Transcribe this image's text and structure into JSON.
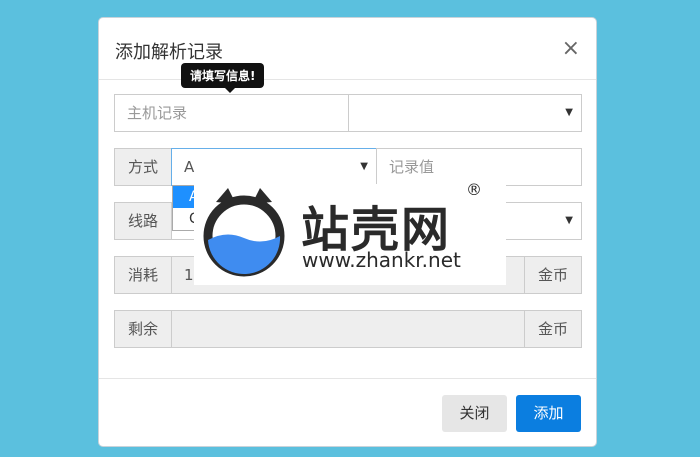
{
  "modal": {
    "title": "添加解析记录",
    "close_glyph": "×"
  },
  "tooltip": "请填写信息!",
  "form": {
    "host_placeholder": "主机记录",
    "method_label": "方式",
    "method_value": "A",
    "record_value_placeholder": "记录值",
    "route_label": "线路",
    "cost_label": "消耗",
    "cost_value": "1",
    "cost_unit": "金币",
    "remain_label": "剩余",
    "remain_unit": "金币"
  },
  "dropdown": {
    "options": [
      "A",
      "C"
    ],
    "selected": "A"
  },
  "footer": {
    "close_label": "关闭",
    "add_label": "添加"
  },
  "watermark": {
    "text": "站壳网",
    "url": "www.zhankr.net",
    "reg": "®"
  },
  "colors": {
    "background": "#5bc0de",
    "primary": "#0b7ee0",
    "watermark_blue": "#3f8cf0"
  }
}
